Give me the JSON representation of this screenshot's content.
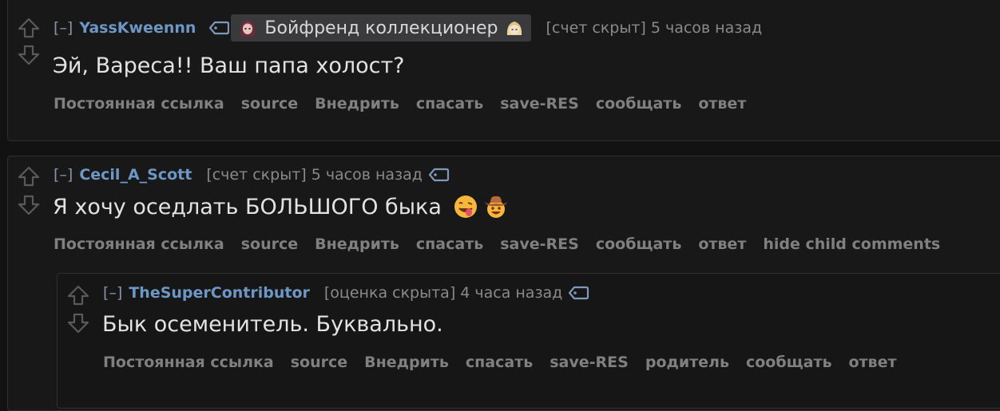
{
  "comments": [
    {
      "collapse": "[–]",
      "author": "YassKweennn",
      "flair": "Бойфренд коллекционер",
      "score": "[счет скрыт]",
      "time": "5 часов назад",
      "body": "Эй, Вареса!! Ваш папа холост?",
      "buttons": [
        "Постоянная ссылка",
        "source",
        "Внедрить",
        "спасать",
        "save-RES",
        "сообщать",
        "ответ"
      ]
    },
    {
      "collapse": "[–]",
      "author": "Cecil_A_Scott",
      "score": "[счет скрыт]",
      "time": "5 часов назад",
      "body": "Я хочу оседлать БОЛЬШОГО быка",
      "emojis": [
        "face-savoring-food-emoji",
        "cowboy-hat-face-emoji"
      ],
      "buttons": [
        "Постоянная ссылка",
        "source",
        "Внедрить",
        "спасать",
        "save-RES",
        "сообщать",
        "ответ",
        "hide child comments"
      ]
    },
    {
      "collapse": "[–]",
      "author": "TheSuperContributor",
      "score": "[оценка скрыта]",
      "time": "4 часа назад",
      "body": "Бык осеменитель. Буквально.",
      "buttons": [
        "Постоянная ссылка",
        "source",
        "Внедрить",
        "спасать",
        "save-RES",
        "родитель",
        "сообщать",
        "ответ"
      ]
    }
  ],
  "colors": {
    "background": "#121212",
    "comment_bg": "#181819",
    "author": "#6d97c4",
    "meta": "#8a8a8a",
    "body": "#e3e3e3",
    "buttons": "#808080"
  }
}
